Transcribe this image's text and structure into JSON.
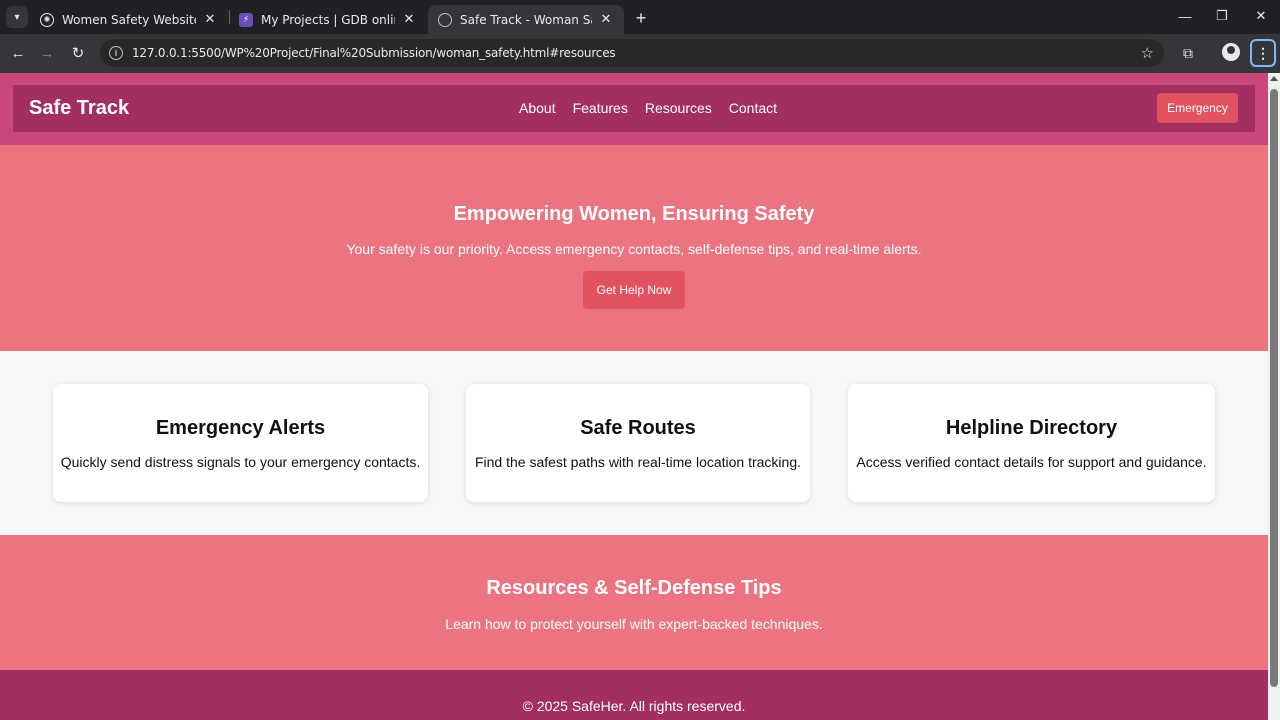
{
  "browser": {
    "tabs": [
      {
        "title": "Women Safety Website Design",
        "icon": "openai-icon"
      },
      {
        "title": "My Projects | GDB online Debugger",
        "icon": "gdb-icon"
      },
      {
        "title": "Safe Track - Woman Safety",
        "icon": "globe-icon"
      }
    ],
    "url": "127.0.0.1:5500/WP%20Project/Final%20Submission/woman_safety.html#resources"
  },
  "header": {
    "brand": "Safe Track",
    "nav": [
      "About",
      "Features",
      "Resources",
      "Contact"
    ],
    "emergency_label": "Emergency"
  },
  "hero": {
    "title": "Empowering Women, Ensuring Safety",
    "subtitle": "Your safety is our priority. Access emergency contacts, self-defense tips, and real-time alerts.",
    "cta_label": "Get Help Now"
  },
  "features": [
    {
      "title": "Emergency Alerts",
      "text": "Quickly send distress signals to your emergency contacts."
    },
    {
      "title": "Safe Routes",
      "text": "Find the safest paths with real-time location tracking."
    },
    {
      "title": "Helpline Directory",
      "text": "Access verified contact details for support and guidance."
    }
  ],
  "resources": {
    "title": "Resources & Self-Defense Tips",
    "text": "Learn how to protect yourself with expert-backed techniques."
  },
  "footer": {
    "text": "© 2025 SafeHer. All rights reserved."
  },
  "colors": {
    "header": "#c9487c",
    "nav_bar": "#a32f62",
    "hero": "#ec7480",
    "button": "#e35260",
    "features_bg": "#f7f7f8"
  }
}
